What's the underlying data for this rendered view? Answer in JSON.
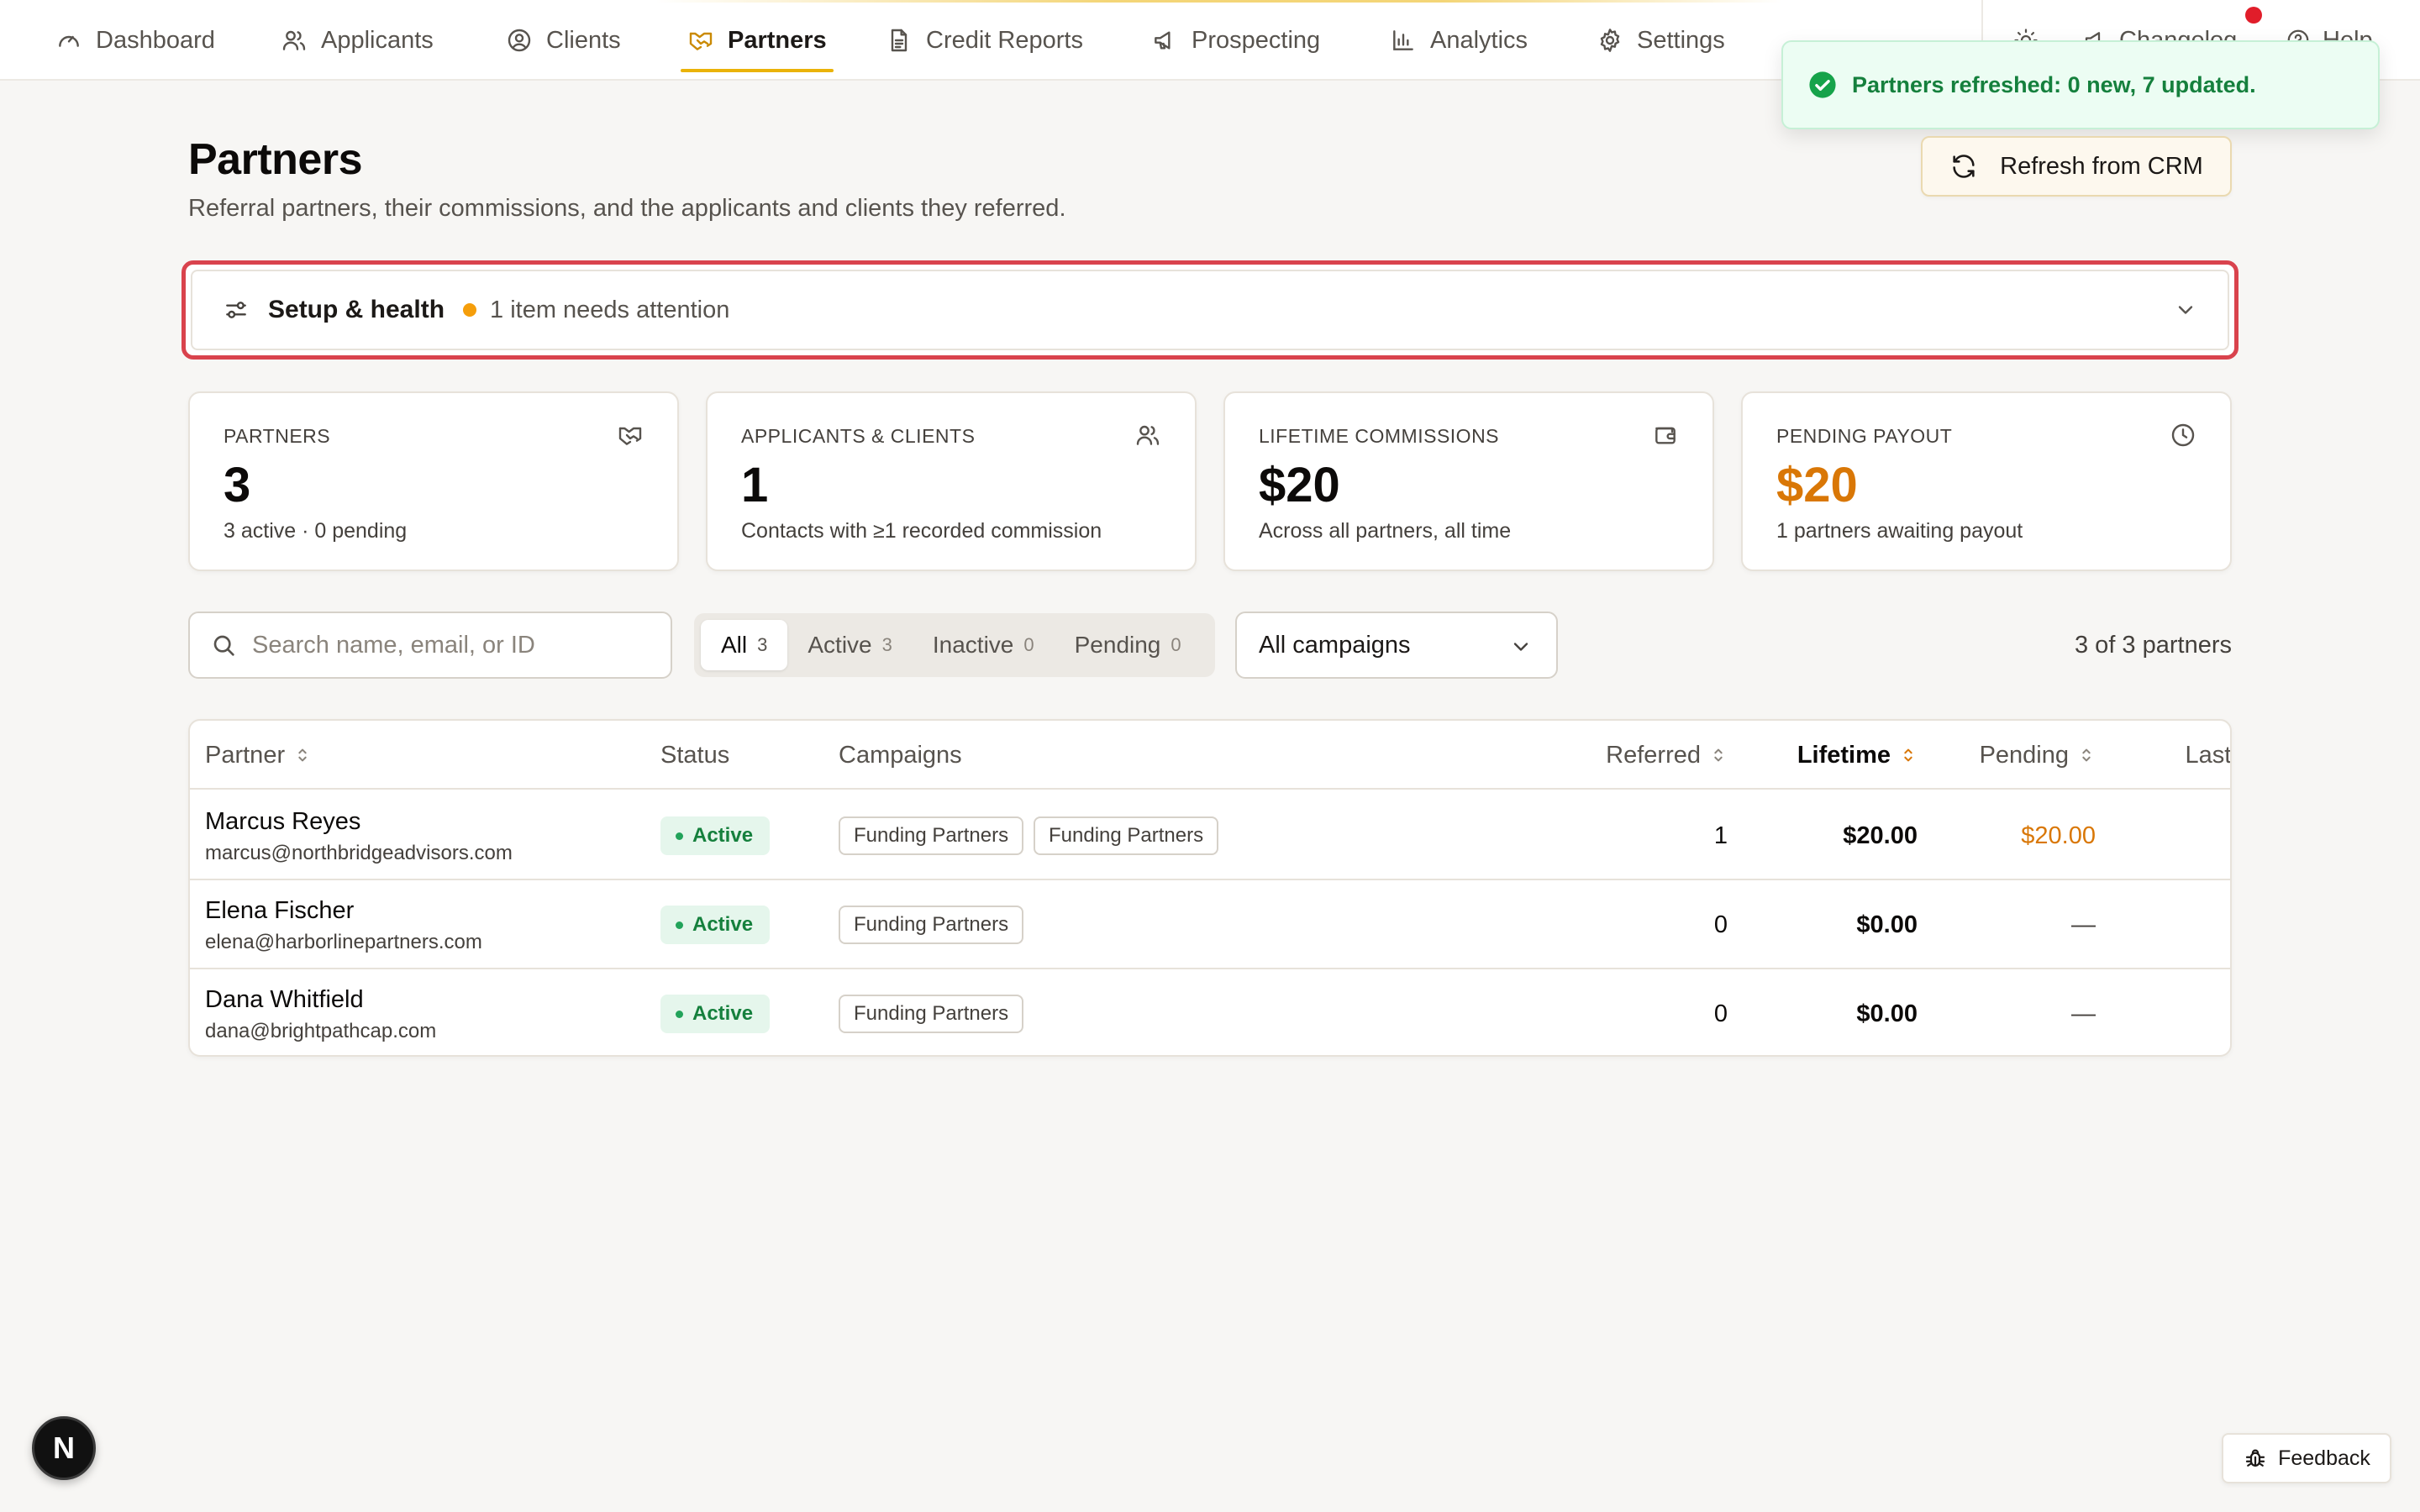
{
  "nav": {
    "items": [
      {
        "label": "Dashboard",
        "icon": "gauge-icon"
      },
      {
        "label": "Applicants",
        "icon": "users-icon"
      },
      {
        "label": "Clients",
        "icon": "user-circle-icon"
      },
      {
        "label": "Partners",
        "icon": "handshake-icon"
      },
      {
        "label": "Credit Reports",
        "icon": "file-text-icon"
      },
      {
        "label": "Prospecting",
        "icon": "megaphone-icon"
      },
      {
        "label": "Analytics",
        "icon": "bar-chart-icon"
      },
      {
        "label": "Settings",
        "icon": "gear-icon"
      }
    ],
    "active": "Partners",
    "utility": [
      {
        "label": "",
        "icon": "sun-icon"
      },
      {
        "label": "Changelog",
        "icon": "megaphone-icon"
      },
      {
        "label": "Help",
        "icon": "help-circle-icon"
      }
    ]
  },
  "toast": {
    "message": "Partners refreshed: 0 new, 7 updated.",
    "icon": "check-circle-icon"
  },
  "header": {
    "title": "Partners",
    "subtitle": "Referral partners, their commissions, and the applicants and clients they referred.",
    "refresh_label": "Refresh from CRM"
  },
  "setup": {
    "title": "Setup & health",
    "status": "1 item needs attention"
  },
  "stats": [
    {
      "label": "PARTNERS",
      "value": "3",
      "sub": "3 active · 0 pending",
      "icon": "handshake-icon"
    },
    {
      "label": "APPLICANTS & CLIENTS",
      "value": "1",
      "sub": "Contacts with ≥1 recorded commission",
      "icon": "users-icon"
    },
    {
      "label": "LIFETIME COMMISSIONS",
      "value": "$20",
      "sub": "Across all partners, all time",
      "icon": "wallet-icon"
    },
    {
      "label": "PENDING PAYOUT",
      "value": "$20",
      "sub": "1 partners awaiting payout",
      "icon": "clock-icon"
    }
  ],
  "filters": {
    "search_placeholder": "Search name, email, or ID",
    "search_value": "",
    "segments": [
      {
        "label": "All",
        "count": "3"
      },
      {
        "label": "Active",
        "count": "3"
      },
      {
        "label": "Inactive",
        "count": "0"
      },
      {
        "label": "Pending",
        "count": "0"
      }
    ],
    "active_segment": "All",
    "campaign": "All campaigns",
    "count_label": "3 of 3 partners"
  },
  "table": {
    "columns": [
      "Partner",
      "Status",
      "Campaigns",
      "Referred",
      "Lifetime",
      "Pending",
      "Last activity"
    ],
    "sorted_column": "Lifetime",
    "rows": [
      {
        "name": "Marcus Reyes",
        "email": "marcus@northbridgeadvisors.com",
        "status": "Active",
        "campaigns": [
          "Funding Partners",
          "Funding Partners"
        ],
        "referred": "1",
        "lifetime": "$20.00",
        "pending": "$20.00",
        "last_activity": "—"
      },
      {
        "name": "Elena Fischer",
        "email": "elena@harborlinepartners.com",
        "status": "Active",
        "campaigns": [
          "Funding Partners"
        ],
        "referred": "0",
        "lifetime": "$0.00",
        "pending": "—",
        "last_activity": "—"
      },
      {
        "name": "Dana Whitfield",
        "email": "dana@brightpathcap.com",
        "status": "Active",
        "campaigns": [
          "Funding Partners"
        ],
        "referred": "0",
        "lifetime": "$0.00",
        "pending": "—",
        "last_activity": "—"
      }
    ]
  },
  "footer": {
    "badge": "N",
    "feedback_label": "Feedback"
  },
  "colors": {
    "accent": "#eab308",
    "pending_orange": "#d97706",
    "success": "#15803d",
    "alert_border": "#d9434d"
  }
}
